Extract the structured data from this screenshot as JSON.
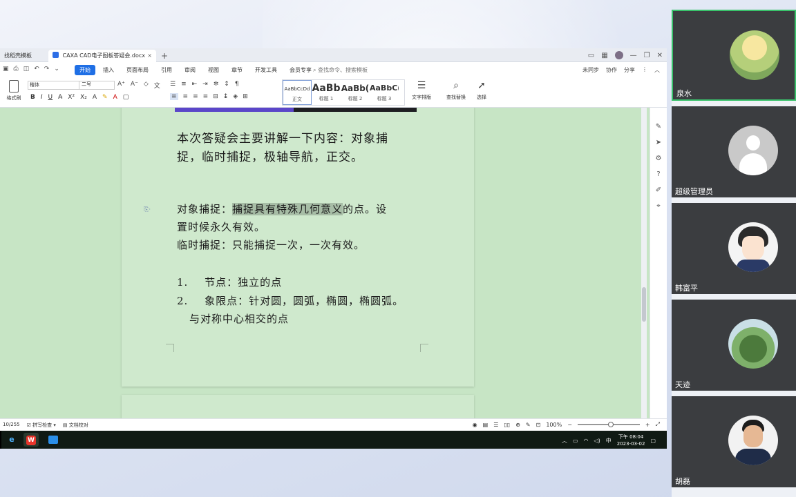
{
  "window": {
    "tabs": [
      {
        "label": "找稻壳模板"
      },
      {
        "label": "CAXA CAD电子图板答疑会.docx"
      }
    ],
    "tab_close": "×",
    "tab_new": "+"
  },
  "menu": {
    "items": [
      "开始",
      "插入",
      "页面布局",
      "引用",
      "审阅",
      "视图",
      "章节",
      "开发工具",
      "会员专享"
    ],
    "search_placeholder": "查找命令、搜索模板",
    "right": [
      "未同步",
      "协作",
      "分享"
    ]
  },
  "ribbon": {
    "format_painter": "格式刷",
    "font_name": "楷体",
    "font_size": "二号",
    "styles": [
      {
        "preview": "AaBbCcDd",
        "label": "正文"
      },
      {
        "preview": "AaBb",
        "label": "标题 1"
      },
      {
        "preview": "AaBb(",
        "label": "标题 2"
      },
      {
        "preview": "AaBbC(",
        "label": "标题 3"
      }
    ],
    "text_layout": "文字排版",
    "find_replace": "查找替换",
    "select": "选择"
  },
  "document": {
    "intro_line1": "本次答疑会主要讲解一下内容：对象捕",
    "intro_line2": "捉，临时捕捉，极轴导航，正交。",
    "p1_prefix": "对象捕捉：",
    "p1_highlight": "捕捉具有特殊几何意义",
    "p1_suffix": "的点。设",
    "p1_line2": "置时候永久有效。",
    "p2": "临时捕捉：只能捕捉一次，一次有效。",
    "list": [
      {
        "num": "1.",
        "text": "节点：独立的点"
      },
      {
        "num": "2.",
        "text": "象限点：针对圆，圆弧，椭圆，椭圆弧。"
      }
    ],
    "list2_cont": "与对称中心相交的点"
  },
  "status": {
    "page_count": "10/255",
    "spell_check": "拼写检查",
    "doc_proof": "文档校对",
    "zoom": "100%"
  },
  "taskbar": {
    "ime": "中",
    "time": "下午 08:04",
    "date": "2023-03-02"
  },
  "participants": [
    {
      "name": "泉水",
      "active": true
    },
    {
      "name": "超级管理员",
      "active": false
    },
    {
      "name": "韩富平",
      "active": false
    },
    {
      "name": "天迹",
      "active": false
    },
    {
      "name": "胡磊",
      "active": false
    }
  ]
}
